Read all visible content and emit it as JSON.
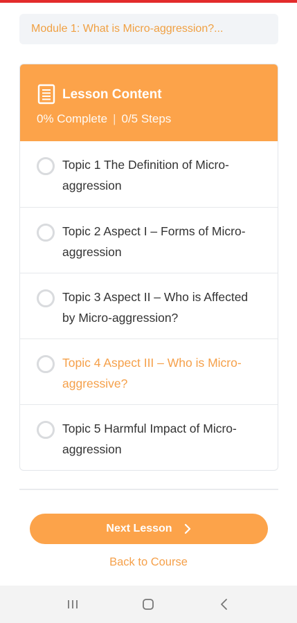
{
  "breadcrumb": {
    "text": "Module 1: What is Micro-aggression?..."
  },
  "lesson": {
    "title": "Lesson Content",
    "progress_percent": "0% Complete",
    "separator": "|",
    "progress_steps": "0/5 Steps",
    "topics": [
      {
        "label": "Topic 1 The Definition of Micro-aggression",
        "completed": false,
        "active": false
      },
      {
        "label": "Topic 2 Aspect I – Forms of Micro-aggression",
        "completed": false,
        "active": false
      },
      {
        "label": "Topic 3 Aspect II – Who is Affected by Micro-aggression?",
        "completed": false,
        "active": false
      },
      {
        "label": "Topic 4 Aspect III – Who is Micro-aggressive?",
        "completed": false,
        "active": true
      },
      {
        "label": "Topic 5 Harmful Impact of Micro-aggression",
        "completed": false,
        "active": false
      }
    ]
  },
  "actions": {
    "next_label": "Next Lesson",
    "back_label": "Back to Course"
  },
  "icons": {
    "header": "document-icon",
    "next": "chevron-right-icon",
    "nav": [
      "recent-apps-icon",
      "home-icon",
      "back-icon"
    ]
  },
  "colors": {
    "accent": "#fca34a",
    "accent_text": "#f5a04a",
    "top_bar": "#e32b2b",
    "breadcrumb_bg": "#f2f4f7"
  }
}
